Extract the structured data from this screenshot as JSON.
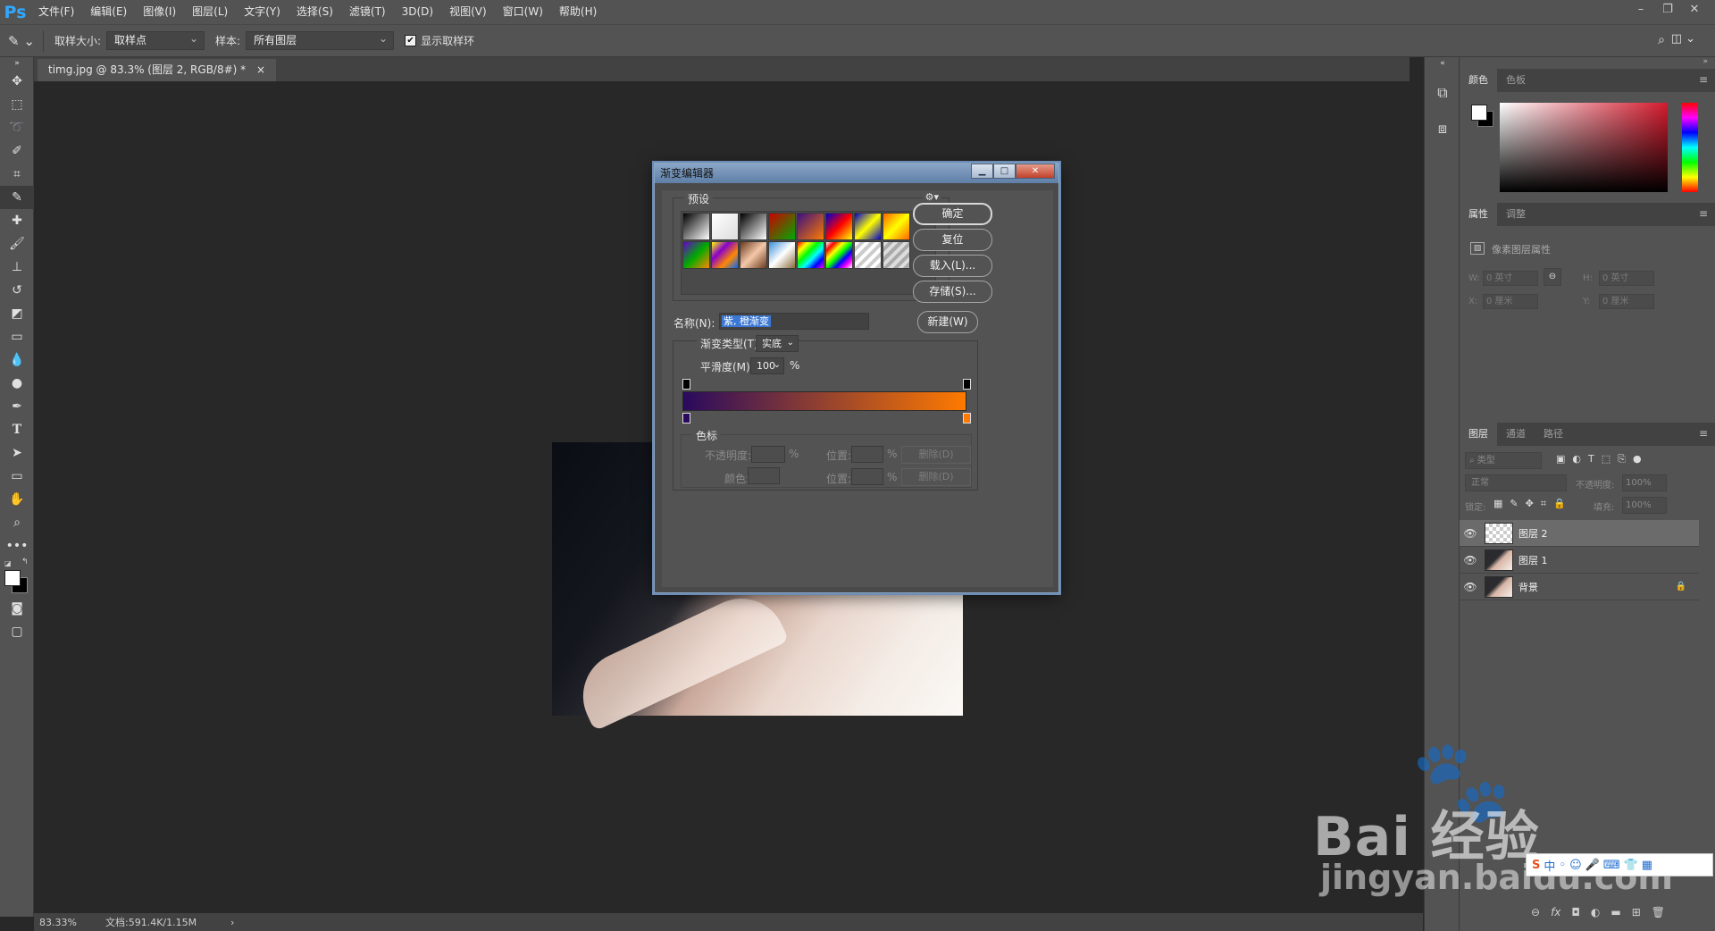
{
  "app": {
    "logo": "Ps"
  },
  "menu": [
    "文件(F)",
    "编辑(E)",
    "图像(I)",
    "图层(L)",
    "文字(Y)",
    "选择(S)",
    "滤镜(T)",
    "3D(D)",
    "视图(V)",
    "窗口(W)",
    "帮助(H)"
  ],
  "options": {
    "sample_size_label": "取样大小:",
    "sample_size_value": "取样点",
    "sample_label": "样本:",
    "sample_value": "所有图层",
    "show_ring_label": "显示取样环",
    "show_ring_checked": true
  },
  "document": {
    "tab_title": "timg.jpg @ 83.3% (图层 2, RGB/8#) *",
    "tab_close": "×"
  },
  "status": {
    "zoom": "83.33%",
    "doc_info": "文档:591.4K/1.15M",
    "arrow": "›"
  },
  "panels": {
    "color": {
      "tabs": [
        "颜色",
        "色板"
      ]
    },
    "properties": {
      "tabs": [
        "属性",
        "调整"
      ],
      "title": "像素图层属性",
      "w_label": "W:",
      "w_value": "0 英寸",
      "h_label": "H:",
      "h_value": "0 英寸",
      "x_label": "X:",
      "x_value": "0 厘米",
      "y_label": "Y:",
      "y_value": "0 厘米"
    },
    "layers": {
      "tabs": [
        "图层",
        "通道",
        "路径"
      ],
      "filter_placeholder": "类型",
      "blend_mode": "正常",
      "opacity_label": "不透明度:",
      "opacity_value": "100%",
      "lock_label": "锁定:",
      "fill_label": "填充:",
      "fill_value": "100%",
      "items": [
        {
          "name": "图层 2",
          "selected": true,
          "thumb": "transparent"
        },
        {
          "name": "图层 1",
          "selected": false,
          "thumb": "photo"
        },
        {
          "name": "背景",
          "selected": false,
          "thumb": "photo",
          "locked": true
        }
      ]
    }
  },
  "dialog": {
    "title": "渐变编辑器",
    "presets_label": "预设",
    "ok": "确定",
    "reset": "复位",
    "load": "载入(L)...",
    "save": "存储(S)...",
    "name_label": "名称(N):",
    "name_value": "紫, 橙渐变",
    "new_button": "新建(W)",
    "type_label": "渐变类型(T):",
    "type_value": "实底",
    "smooth_label": "平滑度(M):",
    "smooth_value": "100",
    "percent": "%",
    "gradient_start": "#2a0a5e",
    "gradient_end": "#ff7a00",
    "stops_group": "色标",
    "opacity_label": "不透明度:",
    "position_label": "位置:",
    "delete_label": "删除(D)",
    "color_label": "颜色:"
  },
  "watermark": {
    "brand": "Bai 经验",
    "url": "jingyan.baidu.com"
  }
}
